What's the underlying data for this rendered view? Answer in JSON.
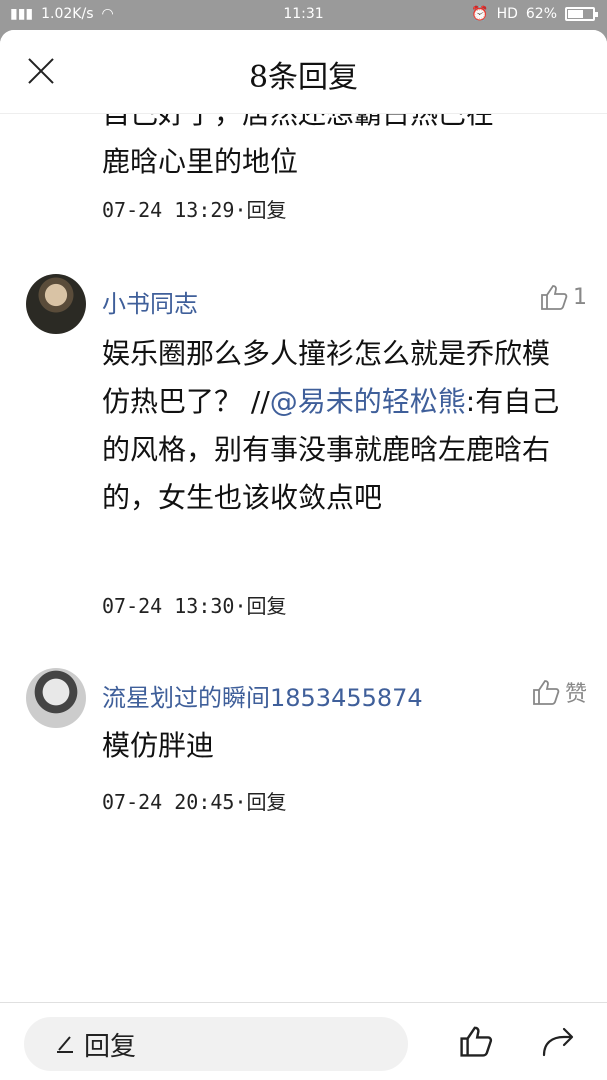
{
  "status_bar": {
    "speed": "1.02K/s",
    "time": "11:31",
    "hd": "HD",
    "battery": "62%",
    "battery_level": 0.62
  },
  "header": {
    "title": "8条回复",
    "close_icon": "close-icon"
  },
  "partial_comment": {
    "cut_text": "自己好了，居然还想霸占热巴在",
    "text": "鹿晗心里的地位",
    "time": "07-24 13:29",
    "reply": "回复"
  },
  "comments": [
    {
      "username": "小书同志",
      "likes": "1",
      "body_before_mention": "娱乐圈那么多人撞衫怎么就是乔欣模仿热巴了？ //",
      "mention": "@易未的轻松熊",
      "body_after_mention": ":有自己的风格，别有事没事就鹿晗左鹿晗右的，女生也该收敛点吧",
      "time": "07-24 13:30",
      "reply": "回复"
    },
    {
      "username": "流星划过的瞬间1853455874",
      "likes": "赞",
      "body": "模仿胖迪",
      "time": "07-24 20:45",
      "reply": "回复"
    }
  ],
  "bottom_bar": {
    "reply_label": "回复",
    "like_icon": "thumbs-up-icon",
    "share_icon": "share-icon"
  },
  "colors": {
    "link": "#3f5f9a",
    "text": "#111111",
    "overlay": "#9a9a9a"
  }
}
